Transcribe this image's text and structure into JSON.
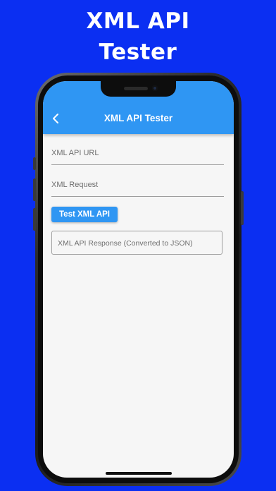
{
  "promo": {
    "title_line1": "XML API",
    "title_line2": "Tester"
  },
  "colors": {
    "background": "#0b2ff2",
    "appbar": "#2f96f3",
    "screen": "#f6f6f6",
    "button": "#2f96f3"
  },
  "app": {
    "appbar": {
      "back_icon": "chevron-left-icon",
      "title": "XML API Tester"
    },
    "form": {
      "url_placeholder": "XML API URL",
      "request_placeholder": "XML Request",
      "test_button_label": "Test XML API",
      "response_placeholder": "XML API Response (Converted to JSON)"
    }
  }
}
